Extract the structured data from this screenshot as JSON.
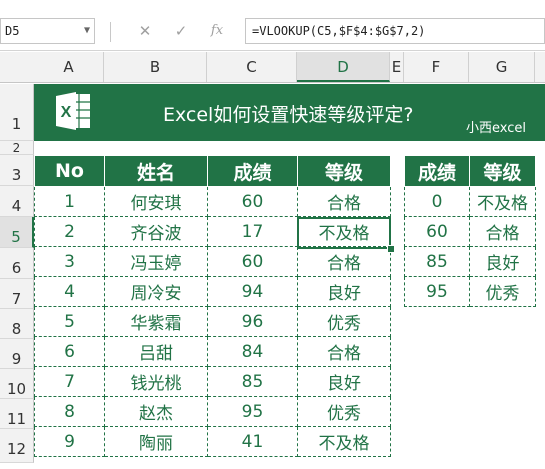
{
  "formula_bar": {
    "name_box": "D5",
    "cancel_icon": "✕",
    "enter_icon": "✓",
    "function_icon": "fx",
    "formula": "=VLOOKUP(C5,$F$4:$G$7,2)"
  },
  "columns": [
    "A",
    "B",
    "C",
    "D",
    "E",
    "F",
    "G"
  ],
  "rows": [
    "1",
    "2",
    "3",
    "4",
    "5",
    "6",
    "7",
    "8",
    "9",
    "10",
    "11",
    "12"
  ],
  "banner": {
    "title": "Excel如何设置快速等级评定?",
    "author": "小西excel",
    "icon_letter": "X",
    "color": "#217346"
  },
  "main_table": {
    "headers": [
      "No",
      "姓名",
      "成绩",
      "等级"
    ],
    "rows": [
      [
        "1",
        "何安琪",
        "60",
        "合格"
      ],
      [
        "2",
        "齐谷波",
        "17",
        "不及格"
      ],
      [
        "3",
        "冯玉婷",
        "60",
        "合格"
      ],
      [
        "4",
        "周冷安",
        "94",
        "良好"
      ],
      [
        "5",
        "华紫霜",
        "96",
        "优秀"
      ],
      [
        "6",
        "吕甜",
        "84",
        "合格"
      ],
      [
        "7",
        "钱光桃",
        "85",
        "良好"
      ],
      [
        "8",
        "赵杰",
        "95",
        "优秀"
      ],
      [
        "9",
        "陶丽",
        "41",
        "不及格"
      ]
    ]
  },
  "lookup_table": {
    "headers": [
      "成绩",
      "等级"
    ],
    "rows": [
      [
        "0",
        "不及格"
      ],
      [
        "60",
        "合格"
      ],
      [
        "85",
        "良好"
      ],
      [
        "95",
        "优秀"
      ]
    ]
  },
  "active_cell": "D5"
}
